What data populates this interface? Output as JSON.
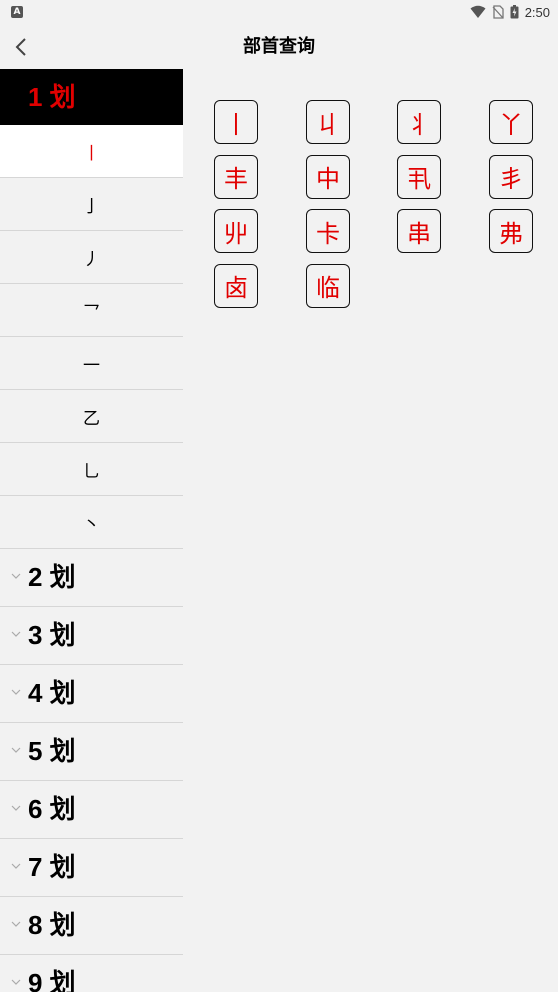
{
  "status_bar": {
    "app_icon": "A",
    "time": "2:50",
    "icons": [
      "wifi-icon",
      "no-sim-icon",
      "battery-charging-icon"
    ]
  },
  "header": {
    "title": "部首查询",
    "back_icon": "chevron-left-icon"
  },
  "sidebar": {
    "groups": [
      {
        "label": "1 划",
        "expanded": true,
        "items": [
          "丨",
          "亅",
          "丿",
          "乛",
          "一",
          "乙",
          "乚",
          "丶"
        ],
        "selected_index": 0
      },
      {
        "label": "2 划",
        "expanded": false
      },
      {
        "label": "3 划",
        "expanded": false
      },
      {
        "label": "4 划",
        "expanded": false
      },
      {
        "label": "5 划",
        "expanded": false
      },
      {
        "label": "6 划",
        "expanded": false
      },
      {
        "label": "7 划",
        "expanded": false
      },
      {
        "label": "8 划",
        "expanded": false
      },
      {
        "label": "9 划",
        "expanded": false
      }
    ]
  },
  "characters": [
    "丨",
    "丩",
    "丬",
    "丫",
    "丰",
    "中",
    "丮",
    "丯",
    "丱",
    "卡",
    "串",
    "弗",
    "卤",
    "临"
  ],
  "colors": {
    "accent": "#e10000",
    "background": "#f2f2f2",
    "active_header_bg": "#000000",
    "selected_item_bg": "#ffffff"
  }
}
